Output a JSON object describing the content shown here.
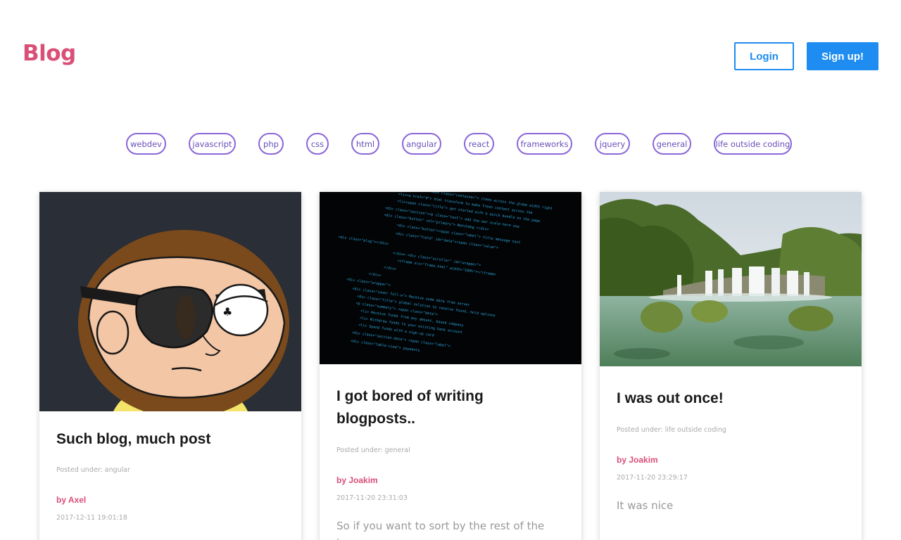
{
  "header": {
    "logo": "Blog",
    "login_label": "Login",
    "signup_label": "Sign up!"
  },
  "tags": [
    "webdev",
    "javascript",
    "php",
    "css",
    "html",
    "angular",
    "react",
    "frameworks",
    "jquery",
    "general",
    "life outside coding"
  ],
  "posts": [
    {
      "title": "Such blog, much post",
      "posted_under": "Posted under: angular",
      "author": "by Axel",
      "date": "2017-12-11 19:01:18",
      "excerpt": ""
    },
    {
      "title": "I got bored of writing blogposts..",
      "posted_under": "Posted under: general",
      "author": "by Joakim",
      "date": "2017-11-20 23:31:03",
      "excerpt": "So if you want to sort by the rest of the tags,"
    },
    {
      "title": "I was out once!",
      "posted_under": "Posted under: life outside coding",
      "author": "by Joakim",
      "date": "2017-11-20 23:29:17",
      "excerpt": "It was nice"
    }
  ],
  "colors": {
    "brand": "#d94f78",
    "accent": "#1e8cf0",
    "tag_border": "#8a67d8"
  }
}
